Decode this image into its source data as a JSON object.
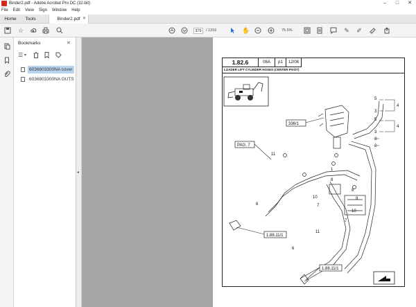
{
  "window": {
    "title": "Binder2.pdf - Adobe Acrobat Pro DC (32-bit)"
  },
  "menu": [
    "File",
    "Edit",
    "View",
    "Sign",
    "Window",
    "Help"
  ],
  "tabs": {
    "home": "Home",
    "tools": "Tools",
    "document": "Binder2.pdf"
  },
  "toolbar": {
    "page_current": "379",
    "page_total": "/ 1316",
    "zoom": "75.5%"
  },
  "bookmarks_panel": {
    "title": "Bookmarks",
    "items": [
      {
        "label": "6036803300NA cover",
        "selected": true
      },
      {
        "label": "6036803300NA GUTS",
        "selected": false
      }
    ]
  },
  "document_page": {
    "header": {
      "section": "1.82.6",
      "code": "08A",
      "part": "p1",
      "date": "12/08"
    },
    "title": "LOADER LIFT CYLINDER HOSES (CENTER PIVOT)",
    "callouts": {
      "ref_336": "336/1",
      "pag7": "PAG. 7",
      "ref_1881a": "1.88.11/1",
      "ref_1881b": "1.88.11/1",
      "n1": "1",
      "n2": "2",
      "n3a": "3",
      "n3b": "3",
      "n3c": "3",
      "n4a": "4",
      "n4b": "4",
      "n5a": "5",
      "n5b": "5",
      "n6a": "6",
      "n6b": "6",
      "n7a": "7",
      "n7b": "7",
      "n8a": "8",
      "n8b": "8",
      "n9": "9",
      "n10a": "10",
      "n10b": "10",
      "n11a": "11",
      "n11b": "11"
    }
  },
  "icons": {
    "app": "acrobat-logo",
    "toolbar": [
      "save-icon",
      "star-icon",
      "upload-icon",
      "print-icon",
      "search-icon",
      "page-up-icon",
      "page-down-icon",
      "pointer-icon",
      "hand-icon",
      "zoom-out-icon",
      "zoom-in-icon",
      "fit-icon",
      "comment-icon",
      "pen-icon",
      "sign-icon",
      "share-icon"
    ]
  }
}
